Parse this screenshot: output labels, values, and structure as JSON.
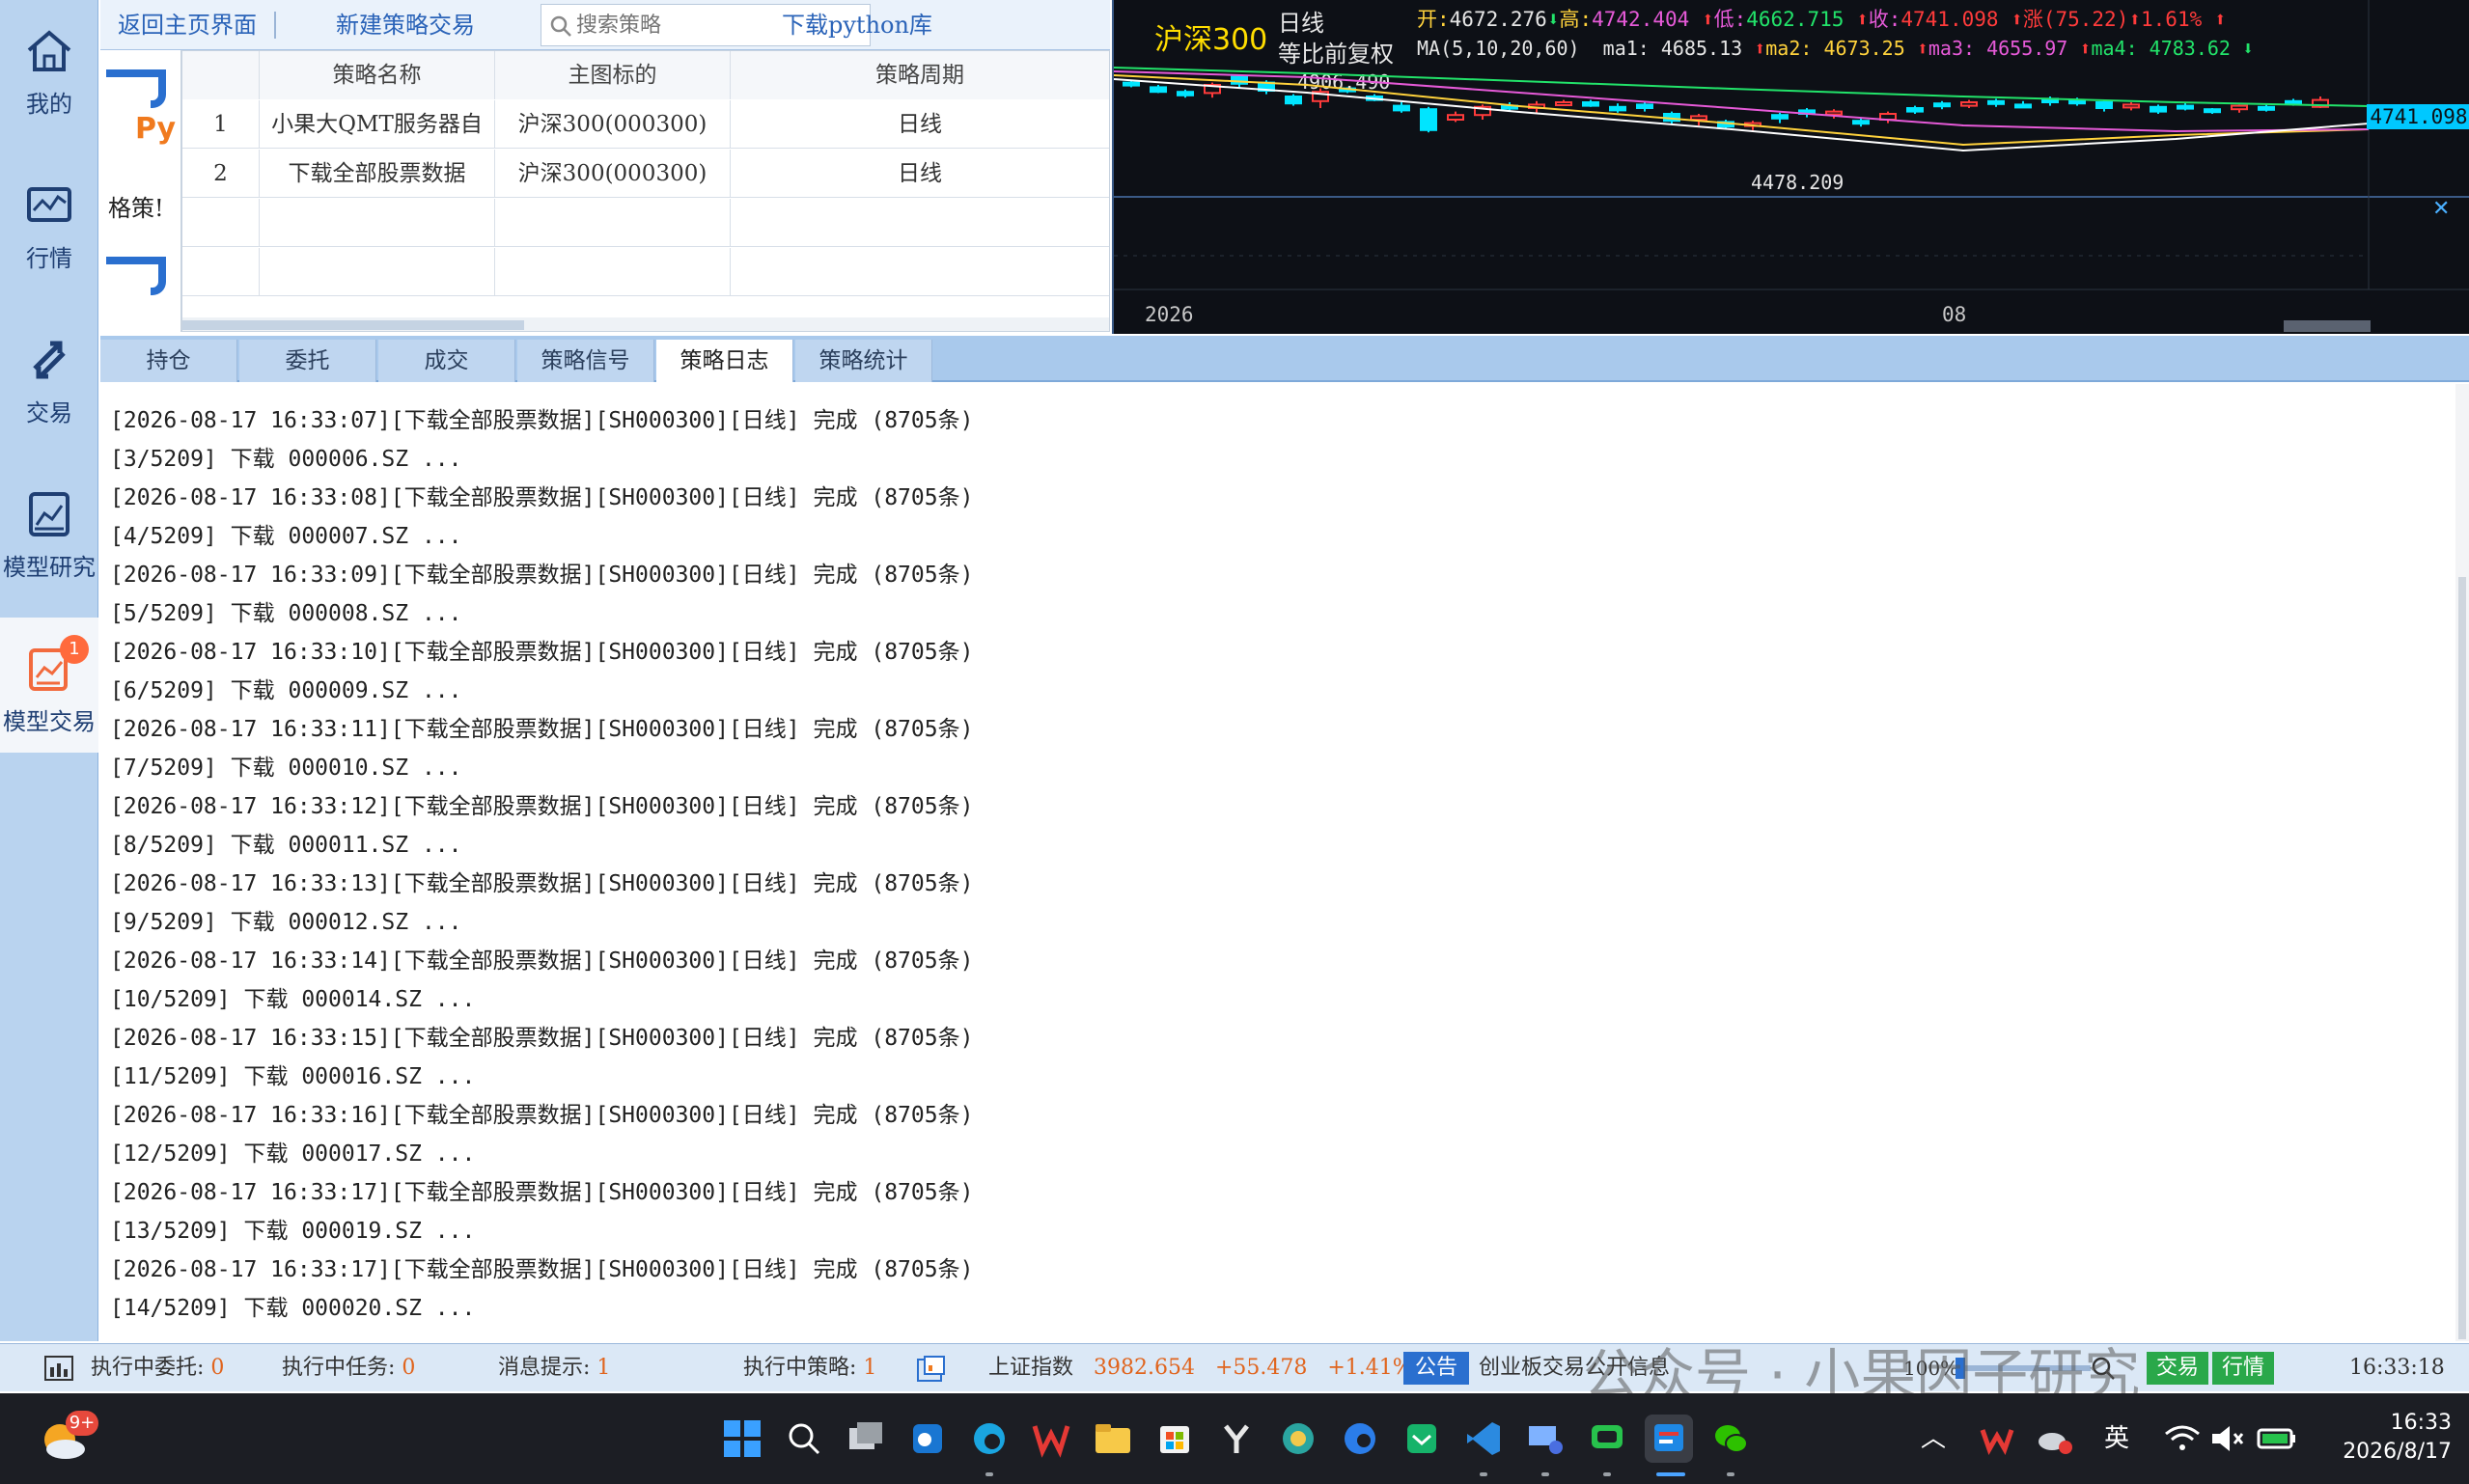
{
  "sidebar": {
    "items": [
      {
        "label": "我的",
        "icon": "home-icon"
      },
      {
        "label": "行情",
        "icon": "chart-icon"
      },
      {
        "label": "交易",
        "icon": "trade-arrows-icon"
      },
      {
        "label": "模型研究",
        "icon": "model-research-icon"
      },
      {
        "label": "模型交易",
        "icon": "model-trade-icon",
        "badge": "1"
      }
    ]
  },
  "toolbar": {
    "back_label": "返回主页界面",
    "new_label": "新建策略交易",
    "search_placeholder": "搜索策略",
    "download_label": "下载python库"
  },
  "icon_column": {
    "py_text": "Py",
    "label": "格策!"
  },
  "strategy_table": {
    "headers": [
      "",
      "策略名称",
      "主图标的",
      "策略周期"
    ],
    "rows": [
      {
        "no": "1",
        "name": "小果大QMT服务器自",
        "symbol": "沪深300(000300)",
        "period": "日线"
      },
      {
        "no": "2",
        "name": "下载全部股票数据",
        "symbol": "沪深300(000300)",
        "period": "日线"
      }
    ]
  },
  "chart": {
    "title": "沪深300",
    "period": "日线",
    "adjust": "等比前复权",
    "open_label": "开:",
    "open": "4672.276",
    "high_label": "高:",
    "high": "4742.404",
    "low_label": "低:",
    "low": "4662.715",
    "close_label": "收:",
    "close": "4741.098",
    "change_label": "涨(75.22)",
    "change_pct": "1.61%",
    "ma_label": "MA(5,10,20,60)",
    "ma1": "ma1: 4685.13",
    "ma2": "ma2: 4673.25",
    "ma3": "ma3: 4655.97",
    "ma4": "ma4: 4783.62",
    "high_mark": "4906.490",
    "low_mark": "4478.209",
    "price_tag": "4741.098",
    "x_labels": [
      "2026",
      "08"
    ],
    "colors": {
      "up": "#ff3b3b",
      "down": "#22e36a",
      "ma1": "#ffffff",
      "ma2": "#ffd23c",
      "ma3": "#e65ad8",
      "ma4": "#22e36a"
    }
  },
  "tabs": [
    "持仓",
    "委托",
    "成交",
    "策略信号",
    "策略日志",
    "策略统计"
  ],
  "active_tab": "策略日志",
  "log_lines": [
    "[2026-08-17 16:33:07][下载全部股票数据][SH000300][日线]  完成 (8705条)",
    "[3/5209] 下载 000006.SZ ...",
    "[2026-08-17 16:33:08][下载全部股票数据][SH000300][日线]  完成 (8705条)",
    "[4/5209] 下载 000007.SZ ...",
    "[2026-08-17 16:33:09][下载全部股票数据][SH000300][日线]  完成 (8705条)",
    "[5/5209] 下载 000008.SZ ...",
    "[2026-08-17 16:33:10][下载全部股票数据][SH000300][日线]  完成 (8705条)",
    "[6/5209] 下载 000009.SZ ...",
    "[2026-08-17 16:33:11][下载全部股票数据][SH000300][日线]  完成 (8705条)",
    "[7/5209] 下载 000010.SZ ...",
    "[2026-08-17 16:33:12][下载全部股票数据][SH000300][日线]  完成 (8705条)",
    "[8/5209] 下载 000011.SZ ...",
    "[2026-08-17 16:33:13][下载全部股票数据][SH000300][日线]  完成 (8705条)",
    "[9/5209] 下载 000012.SZ ...",
    "[2026-08-17 16:33:14][下载全部股票数据][SH000300][日线]  完成 (8705条)",
    "[10/5209] 下载 000014.SZ ...",
    "[2026-08-17 16:33:15][下载全部股票数据][SH000300][日线]  完成 (8705条)",
    "[11/5209] 下载 000016.SZ ...",
    "[2026-08-17 16:33:16][下载全部股票数据][SH000300][日线]  完成 (8705条)",
    "[12/5209] 下载 000017.SZ ...",
    "[2026-08-17 16:33:17][下载全部股票数据][SH000300][日线]  完成 (8705条)",
    "[13/5209] 下载 000019.SZ ...",
    "[2026-08-17 16:33:17][下载全部股票数据][SH000300][日线]  完成 (8705条)",
    "[14/5209] 下载 000020.SZ ..."
  ],
  "status": {
    "pending_orders_label": "执行中委托:",
    "pending_orders": "0",
    "pending_tasks_label": "执行中任务:",
    "pending_tasks": "0",
    "messages_label": "消息提示:",
    "messages": "1",
    "running_strategies_label": "执行中策略:",
    "running_strategies": "1",
    "index_name": "上证指数",
    "index_value": "3982.654",
    "index_change": "+55.478",
    "index_pct": "+1.41%",
    "notice_label": "公告",
    "notice_text": "创业板交易公开信息",
    "zoom": "100%",
    "trade_btn": "交易",
    "quote_btn": "行情",
    "time": "16:33:18"
  },
  "watermark": "公众号 · 小果因子研究",
  "taskbar": {
    "weather_badge": "9+",
    "ime": "英",
    "clock_time": "16:33",
    "clock_date": "2026/8/17"
  }
}
